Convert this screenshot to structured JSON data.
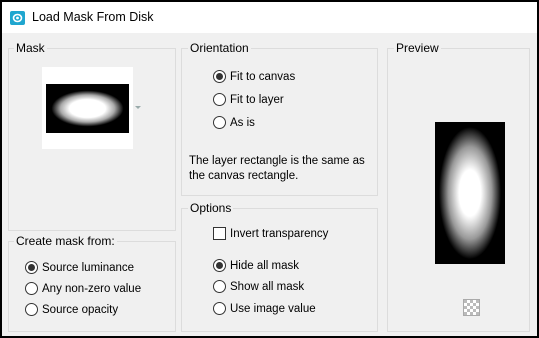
{
  "window": {
    "title": "Load Mask From Disk",
    "title_icon": "psp-mask-icon"
  },
  "mask_group": {
    "label": "Mask",
    "dropdown_icon": "chevron-down-icon"
  },
  "create_mask_group": {
    "label": "Create mask from:",
    "options": [
      {
        "label": "Source luminance",
        "checked": true
      },
      {
        "label": "Any non-zero value",
        "checked": false
      },
      {
        "label": "Source opacity",
        "checked": false
      }
    ]
  },
  "orientation_group": {
    "label": "Orientation",
    "options": [
      {
        "label": "Fit to canvas",
        "checked": true
      },
      {
        "label": "Fit to layer",
        "checked": false
      },
      {
        "label": "As is",
        "checked": false
      }
    ],
    "note": "The layer rectangle is the same as the canvas rectangle."
  },
  "options_group": {
    "label": "Options",
    "invert_label": "Invert transparency",
    "invert_checked": false,
    "mask_options": [
      {
        "label": "Hide all mask",
        "checked": true
      },
      {
        "label": "Show all mask",
        "checked": false
      },
      {
        "label": "Use image value",
        "checked": false
      }
    ]
  },
  "preview_group": {
    "label": "Preview",
    "transparency_icon": "checkerboard-icon"
  },
  "colors": {
    "dialog_bg": "#f0f0f0",
    "title_bg": "#ffffff",
    "icon_accent": "#1fa6cf"
  }
}
